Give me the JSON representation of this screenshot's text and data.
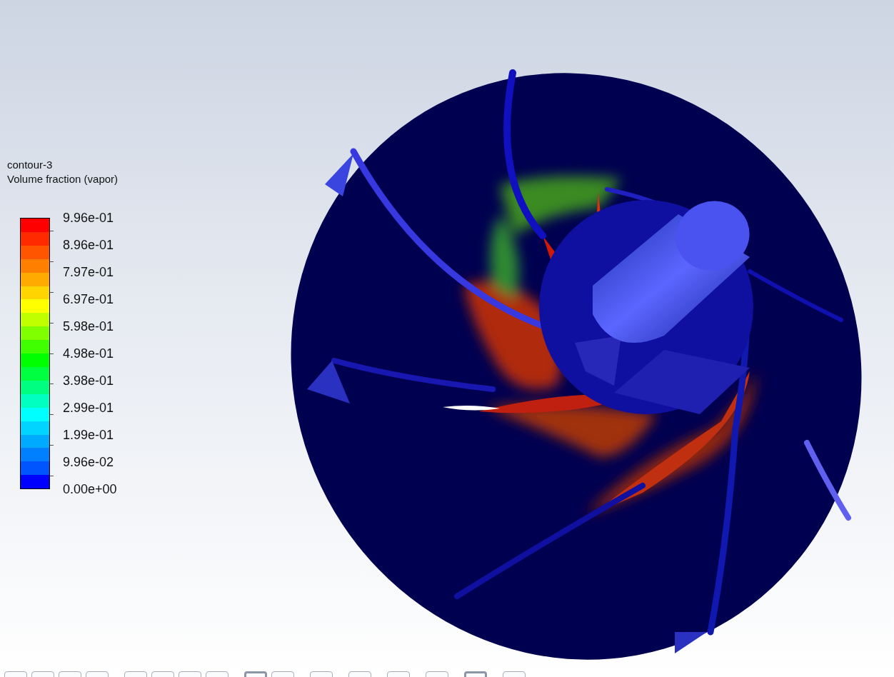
{
  "legend": {
    "title": "contour-3",
    "quantity": "Volume fraction (vapor)",
    "bands": [
      {
        "color": "#ff0000"
      },
      {
        "color": "#ff2a00"
      },
      {
        "color": "#ff5500"
      },
      {
        "color": "#ff7f00"
      },
      {
        "color": "#ffaa00"
      },
      {
        "color": "#ffd400"
      },
      {
        "color": "#ffff00"
      },
      {
        "color": "#c0ff00"
      },
      {
        "color": "#80ff00"
      },
      {
        "color": "#40ff00"
      },
      {
        "color": "#00ff00"
      },
      {
        "color": "#00ff40"
      },
      {
        "color": "#00ff80"
      },
      {
        "color": "#00ffc0"
      },
      {
        "color": "#00ffff"
      },
      {
        "color": "#00d4ff"
      },
      {
        "color": "#00aaff"
      },
      {
        "color": "#0080ff"
      },
      {
        "color": "#0055ff"
      },
      {
        "color": "#0000ff"
      }
    ],
    "labels": [
      "9.96e-01",
      "8.96e-01",
      "7.97e-01",
      "6.97e-01",
      "5.98e-01",
      "4.98e-01",
      "3.98e-01",
      "2.99e-01",
      "1.99e-01",
      "9.96e-02",
      "0.00e+00"
    ]
  },
  "toolbar": {
    "groups": [
      [
        {
          "selected": false
        },
        {
          "selected": false
        },
        {
          "selected": false
        },
        {
          "selected": false
        }
      ],
      [
        {
          "selected": false
        },
        {
          "selected": false
        },
        {
          "selected": false
        },
        {
          "selected": false
        }
      ],
      [
        {
          "selected": true
        },
        {
          "selected": false
        }
      ],
      [
        {
          "selected": false
        }
      ],
      [
        {
          "selected": false
        }
      ],
      [
        {
          "selected": false
        }
      ],
      [
        {
          "selected": false
        }
      ],
      [
        {
          "selected": true
        }
      ],
      [
        {
          "selected": false
        }
      ]
    ]
  }
}
